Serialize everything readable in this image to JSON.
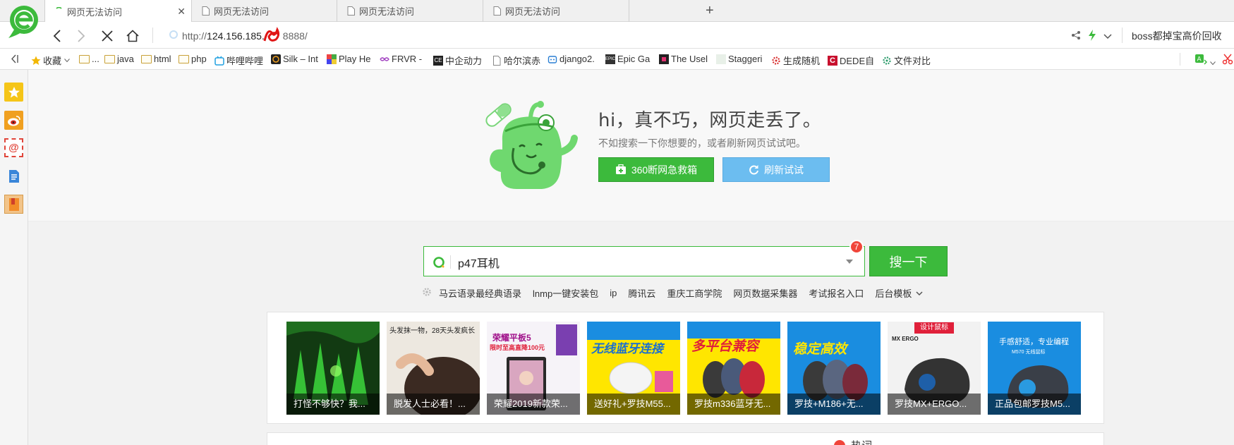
{
  "browser": {
    "tabs": [
      {
        "title": "网页无法访问",
        "active": true
      },
      {
        "title": "网页无法访问",
        "active": false
      },
      {
        "title": "网页无法访问",
        "active": false
      },
      {
        "title": "网页无法访问",
        "active": false
      }
    ],
    "address": {
      "scheme": "http://",
      "host": "124.156.185.",
      "rest": "8888/"
    },
    "promo": "boss都掉宝高价回收"
  },
  "bookmarks": [
    {
      "label": "收藏",
      "icon": "star-icon"
    },
    {
      "label": "...",
      "icon": "folder-icon"
    },
    {
      "label": "java",
      "icon": "folder-icon"
    },
    {
      "label": "html",
      "icon": "folder-icon"
    },
    {
      "label": "php",
      "icon": "folder-icon"
    },
    {
      "label": "哔哩哔哩",
      "icon": "bilibili-icon"
    },
    {
      "label": "Silk – Int",
      "icon": "silk-icon"
    },
    {
      "label": "Play He",
      "icon": "play-icon"
    },
    {
      "label": "FRVR -",
      "icon": "frvr-icon"
    },
    {
      "label": "中企动力",
      "icon": "ce-icon"
    },
    {
      "label": "哈尔滨赤",
      "icon": "page-icon"
    },
    {
      "label": "django2.",
      "icon": "robot-icon"
    },
    {
      "label": "Epic Ga",
      "icon": "epic-icon"
    },
    {
      "label": "The Usel",
      "icon": "square-icon"
    },
    {
      "label": "Staggeri",
      "icon": "blank-icon"
    },
    {
      "label": "生成随机",
      "icon": "gear-red-icon"
    },
    {
      "label": "DEDE自",
      "icon": "dede-icon"
    },
    {
      "label": "文件对比",
      "icon": "gear-green-icon"
    }
  ],
  "error": {
    "title": "hi，真不巧，网页走丢了。",
    "subtitle": "不如搜索一下你想要的，或者刷新网页试试吧。",
    "rescue_button": "360断网急救箱",
    "refresh_button": "刷新试试"
  },
  "search": {
    "query": "p47耳机",
    "badge_count": "7",
    "button": "搜一下",
    "hot_links": [
      "马云语录最经典语录",
      "lnmp一键安装包",
      "ip",
      "腾讯云",
      "重庆工商学院",
      "网页数据采集器",
      "考试报名入口",
      "后台模板"
    ]
  },
  "ads": [
    {
      "caption": "打怪不够快？我...",
      "bg": "#1e5a1e"
    },
    {
      "caption": "脱发人士必看！...",
      "bg": "#e9e4dc",
      "headline": "头发抹一物，28天头发疯长"
    },
    {
      "caption": "荣耀2019新款荣...",
      "bg": "#f6f3f8",
      "headline": "荣耀平板5",
      "sub": "限时至高直降100元"
    },
    {
      "caption": "送好礼+罗技M55...",
      "bg": "#ffe600",
      "headline": "无线蓝牙连接"
    },
    {
      "caption": "罗技m336蓝牙无...",
      "bg": "#ffe600",
      "headline": "多平台兼容"
    },
    {
      "caption": "罗技+M186+无...",
      "bg": "#1a8de0",
      "headline": "稳定高效"
    },
    {
      "caption": "罗技MX+ERGO...",
      "bg": "#f2f2f2",
      "headline": "设计鼠标",
      "sub": "MX ERGO"
    },
    {
      "caption": "正品包邮罗技M5...",
      "bg": "#1a8de0",
      "headline": "手感舒适，专业编程",
      "sub": "M570 无线鼠标"
    }
  ],
  "bottom": {
    "label": "热词"
  }
}
